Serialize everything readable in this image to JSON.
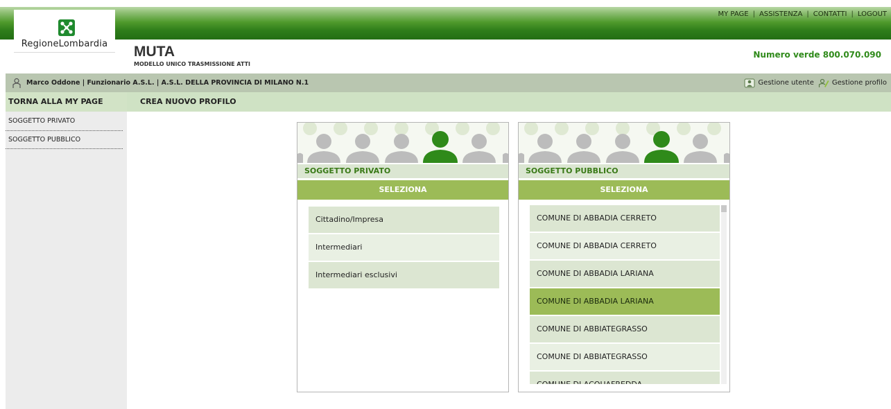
{
  "header": {
    "links": [
      "MY PAGE",
      "ASSISTENZA",
      "CONTATTI",
      "LOGOUT"
    ],
    "logo_text": "RegioneLombardia",
    "app_title": "MUTA",
    "app_subtitle": "MODELLO UNICO TRASMISSIONE ATTI",
    "phone": "Numero verde 800.070.090"
  },
  "user_bar": {
    "user_info": "Marco Oddone | Funzionario A.S.L. | A.S.L. DELLA PROVINCIA DI MILANO N.1",
    "gestione_utente": "Gestione utente",
    "gestione_profilo": "Gestione profilo"
  },
  "sidebar": {
    "back": "TORNA ALLA MY PAGE",
    "items": [
      "SOGGETTO PRIVATO",
      "SOGGETTO PUBBLICO"
    ]
  },
  "content": {
    "title": "CREA NUOVO PROFILO"
  },
  "panels": {
    "private": {
      "label": "SOGGETTO PRIVATO",
      "select": "SELEZIONA",
      "rows": [
        "Cittadino/Impresa",
        "Intermediari",
        "Intermediari esclusivi"
      ]
    },
    "public": {
      "label": "SOGGETTO PUBBLICO",
      "select": "SELEZIONA",
      "rows": [
        "COMUNE DI ABBADIA CERRETO",
        "COMUNE DI ABBADIA CERRETO",
        "COMUNE DI ABBADIA LARIANA",
        "COMUNE DI ABBADIA LARIANA",
        "COMUNE DI ABBIATEGRASSO",
        "COMUNE DI ABBIATEGRASSO",
        "COMUNE DI ACQUAFREDDA"
      ],
      "selected_index": 3
    }
  },
  "colors": {
    "brand_green": "#2e7d1a",
    "accent_green": "#9cbb57",
    "label_green": "#3a7a18"
  }
}
